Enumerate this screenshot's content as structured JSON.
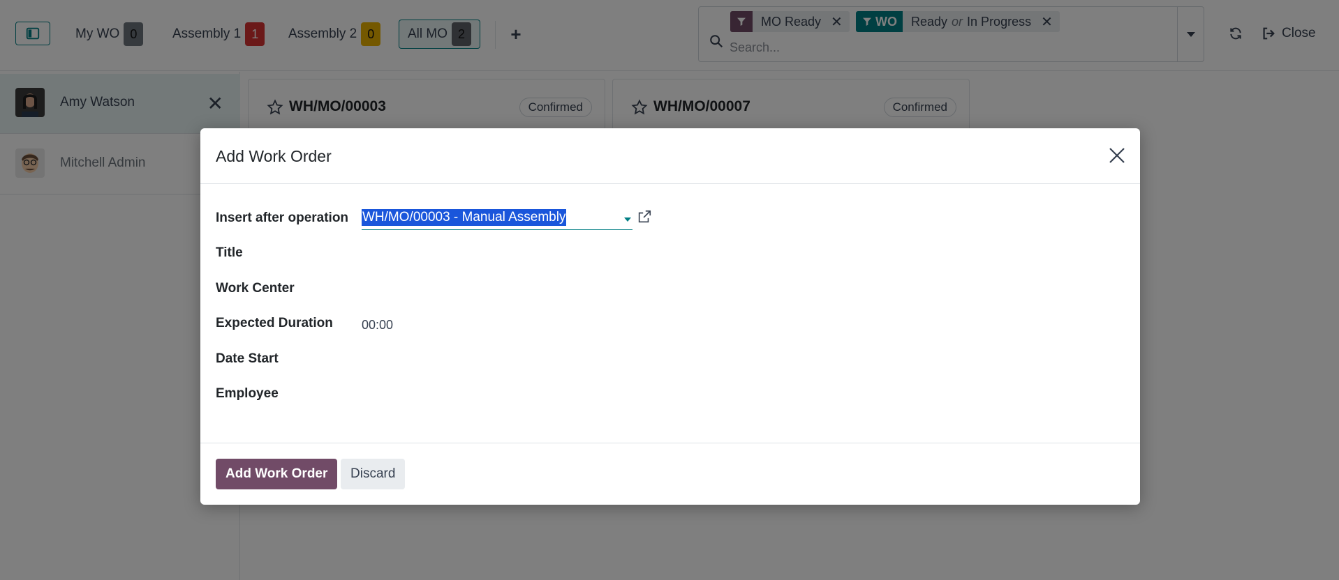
{
  "topbar": {
    "tabs": [
      {
        "label": "My WO",
        "count": "0"
      },
      {
        "label": "Assembly 1",
        "count": "1"
      },
      {
        "label": "Assembly 2",
        "count": "0"
      },
      {
        "label": "All MO",
        "count": "2"
      }
    ],
    "add_icon": "plus-icon",
    "search": {
      "facets": [
        {
          "icon_label": "",
          "icon": "filter-icon",
          "value": "MO Ready",
          "color": "#714b67"
        },
        {
          "icon_label": "WO",
          "icon": "filter-icon",
          "value_a": "Ready",
          "separator": "or",
          "value_b": "In Progress",
          "color": "#017e84"
        }
      ],
      "placeholder": "Search..."
    },
    "close_label": "Close"
  },
  "employees": [
    {
      "name": "Amy Watson",
      "active": true
    },
    {
      "name": "Mitchell Admin",
      "active": false
    }
  ],
  "cards": [
    {
      "name": "WH/MO/00003",
      "status": "Confirmed"
    },
    {
      "name": "WH/MO/00007",
      "status": "Confirmed"
    }
  ],
  "modal": {
    "title": "Add Work Order",
    "fields": {
      "insert_after_label": "Insert after operation",
      "insert_after_value": "WH/MO/00003 - Manual Assembly",
      "title_label": "Title",
      "work_center_label": "Work Center",
      "expected_duration_label": "Expected Duration",
      "expected_duration_value": "00:00",
      "date_start_label": "Date Start",
      "employee_label": "Employee"
    },
    "primary_button": "Add Work Order",
    "secondary_button": "Discard"
  },
  "colors": {
    "brand": "#714b67",
    "accent": "#017e84",
    "badge_red": "#d63333",
    "badge_yellow": "#e9b000"
  }
}
